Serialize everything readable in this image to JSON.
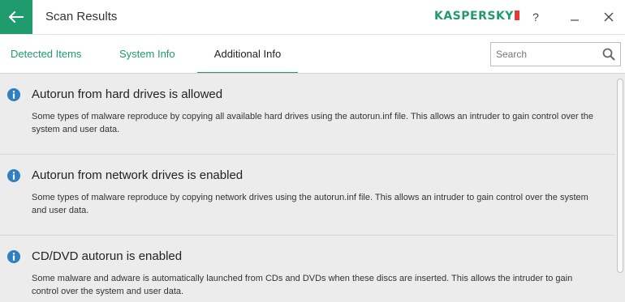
{
  "window": {
    "title": "Scan Results",
    "brand": "KASPERSKY",
    "help_label": "?"
  },
  "icons": {
    "back": "back-arrow-icon",
    "minimize": "minimize-icon",
    "close": "close-icon",
    "search": "search-icon",
    "info": "info-icon"
  },
  "colors": {
    "accent": "#1f9b6e",
    "info_icon": "#2f7fc1",
    "content_bg": "#ececec"
  },
  "tabs": [
    {
      "label": "Detected Items",
      "active": false
    },
    {
      "label": "System Info",
      "active": false
    },
    {
      "label": "Additional Info",
      "active": true
    }
  ],
  "search": {
    "placeholder": "Search",
    "value": ""
  },
  "items": [
    {
      "title": "Autorun from hard drives is allowed",
      "description": "Some types of malware reproduce by copying all available hard drives using the autorun.inf file. This allows an intruder to gain control over the system and user data."
    },
    {
      "title": "Autorun from network drives is enabled",
      "description": "Some types of malware reproduce by copying network drives using the autorun.inf file. This allows an intruder to gain control over the system and user data."
    },
    {
      "title": "CD/DVD autorun is enabled",
      "description": "Some malware and adware is automatically launched from CDs and DVDs when these discs are inserted. This allows the intruder to gain control over the system and user data."
    }
  ]
}
